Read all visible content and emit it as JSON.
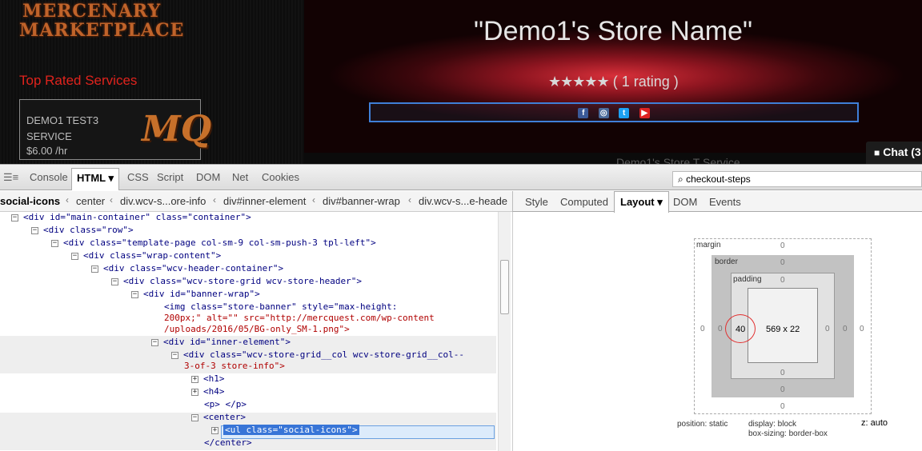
{
  "site": {
    "logo_line1": "MERCENARY",
    "logo_line2": "MARKETPLACE",
    "top_rated": "Top Rated Services",
    "service": {
      "name": "DEMO1 TEST3 SERVICE",
      "price": "$6.00 /hr",
      "logo": "MQ"
    },
    "store_name": "\"Demo1's Store Name\"",
    "stars": "★★★★★",
    "rating_text": "( 1 rating )",
    "social_icons": [
      {
        "icon": "facebook-icon",
        "glyph": "f"
      },
      {
        "icon": "instagram-icon",
        "glyph": "◎"
      },
      {
        "icon": "twitter-icon",
        "glyph": "t"
      },
      {
        "icon": "youtube-icon",
        "glyph": "▶"
      }
    ],
    "chat_label": "Chat (3",
    "faint_text": "Demo1's Store T Service"
  },
  "devtools": {
    "tabs": [
      "Console",
      "HTML ▾",
      "CSS",
      "Script",
      "DOM",
      "Net",
      "Cookies"
    ],
    "active_tab": "HTML ▾",
    "search_value": "checkout-steps",
    "breadcrumbs": [
      "social-icons",
      "center",
      "div.wcv-s...ore-info",
      "div#inner-element",
      "div#banner-wrap",
      "div.wcv-s...e-heade"
    ],
    "side_tabs": [
      "Style",
      "Computed",
      "Layout ▾",
      "DOM",
      "Events"
    ],
    "tree": [
      {
        "t": "<div id=\"main-container\" class=\"container\">"
      },
      {
        "t": "<div class=\"row\">"
      },
      {
        "t": "<div class=\"template-page col-sm-9 col-sm-push-3 tpl-left\">"
      },
      {
        "t": "<div class=\"wrap-content\">"
      },
      {
        "t": "<div class=\"wcv-header-container\">"
      },
      {
        "t": "<div class=\"wcv-store-grid wcv-store-header\">"
      },
      {
        "t": "<div id=\"banner-wrap\">"
      },
      {
        "t": "<img class=\"store-banner\" style=\"max-height:"
      },
      {
        "t": "200px;\" alt=\"\" src=\"http://mercquest.com/wp-content"
      },
      {
        "t": "/uploads/2016/05/BG-only_SM-1.png\">"
      },
      {
        "t": "<div id=\"inner-element\">"
      },
      {
        "t": "<div class=\"wcv-store-grid__col wcv-store-grid__col--"
      },
      {
        "t": "3-of-3 store-info\">"
      },
      {
        "t": "<h1>"
      },
      {
        "t": "<h4>"
      },
      {
        "t": "<p> </p>"
      },
      {
        "t": "<center>"
      },
      {
        "t": "<ul class=\"social-icons\">"
      },
      {
        "t": "</center>"
      }
    ],
    "layout": {
      "margin_label": "margin",
      "border_label": "border",
      "padding_label": "padding",
      "zero": "0",
      "padding_left": "40",
      "content_size": "569 x 22",
      "position": "position: static",
      "display": "display: block",
      "box_sizing": "box-sizing: border-box",
      "z": "z: auto"
    }
  }
}
